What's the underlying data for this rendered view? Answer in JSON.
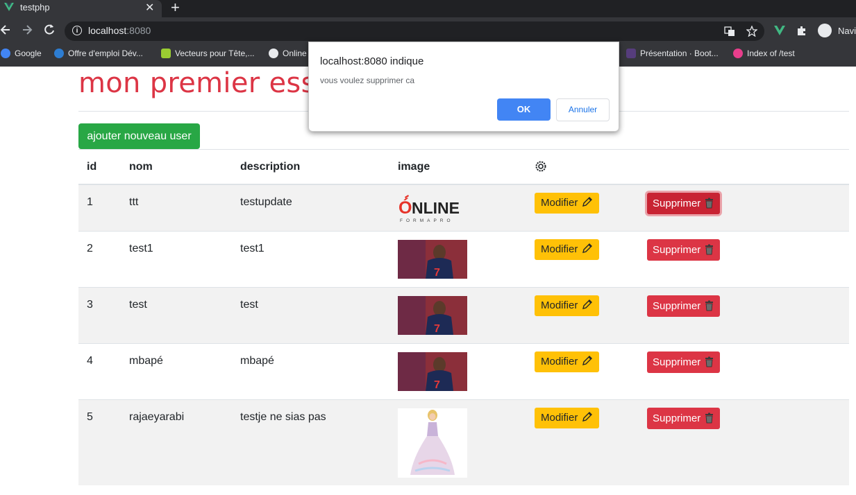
{
  "browser": {
    "tab_title": "testphp",
    "url_host": "localhost",
    "url_port": ":8080",
    "profile_label": "Navig",
    "bookmarks": [
      {
        "label": "Google",
        "icon": "google-icon",
        "color": "#4285f4"
      },
      {
        "label": "Offre d'emploi Dév...",
        "icon": "ie-icon",
        "color": "#2d7dd2"
      },
      {
        "label": "Vecteurs pour Tête,...",
        "icon": "vector-icon",
        "color": "#9acd32"
      },
      {
        "label": "Online",
        "icon": "globe-icon",
        "color": "#e8eaed"
      },
      {
        "label": "Présentation · Boot...",
        "icon": "bootstrap-icon",
        "color": "#563d7c"
      },
      {
        "label": "Index of /test",
        "icon": "wamp-icon",
        "color": "#e83e8c"
      }
    ]
  },
  "page": {
    "title": "mon premier essai",
    "add_button": "ajouter nouveau user",
    "columns": [
      "id",
      "nom",
      "description",
      "image"
    ],
    "modify_label": "Modifier",
    "delete_label": "Supprimer",
    "rows": [
      {
        "id": "1",
        "nom": "ttt",
        "description": "testupdate",
        "image": "online-formapro-logo"
      },
      {
        "id": "2",
        "nom": "test1",
        "description": "test1",
        "image": "football-player-photo"
      },
      {
        "id": "3",
        "nom": "test",
        "description": "test",
        "image": "football-player-photo"
      },
      {
        "id": "4",
        "nom": "mbapé",
        "description": "mbapé",
        "image": "football-player-photo"
      },
      {
        "id": "5",
        "nom": "rajaeyarabi",
        "description": "testje ne sias pas",
        "image": "doll-photo"
      }
    ]
  },
  "dialog": {
    "title": "localhost:8080 indique",
    "message": "vous voulez supprimer ca",
    "ok": "OK",
    "cancel": "Annuler"
  },
  "colors": {
    "danger": "#dc3545",
    "warning": "#ffc107",
    "success": "#28a745",
    "dialog_primary": "#4285f4"
  }
}
